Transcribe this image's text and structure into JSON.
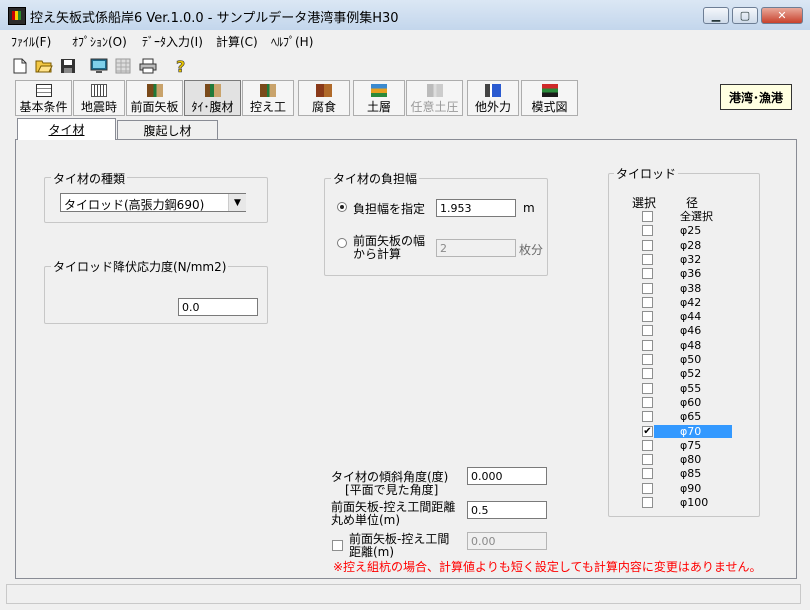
{
  "window": {
    "title": "控え矢板式係船岸6 Ver.1.0.0 - サンプルデータ港湾事例集H30"
  },
  "menu": [
    "ﾌｧｲﾙ(F)",
    "ｵﾌﾟｼｮﾝ(O)",
    "ﾃﾞｰﾀ入力(I)",
    "計算(C)",
    "ﾍﾙﾌﾟ(H)"
  ],
  "toolbar_icons": [
    "new-file-icon",
    "open-folder-icon",
    "save-icon",
    "monitor-icon",
    "table-icon",
    "printer-icon",
    "help-icon"
  ],
  "nav_buttons": [
    "基本条件",
    "地震時",
    "前面矢板",
    "ﾀｲ･腹材",
    "控え工",
    "腐食",
    "土層",
    "任意土圧",
    "他外力",
    "模式図"
  ],
  "region_badge": "港湾･漁港",
  "tabs": [
    "タイ材",
    "腹起し材"
  ],
  "tie_type": {
    "title": "タイ材の種類",
    "value": "タイロッド(高張力鋼690)"
  },
  "yield": {
    "title": "タイロッド降伏応力度(N/mm2)",
    "value": "0.0"
  },
  "load_width": {
    "title": "タイ材の負担幅",
    "opt_specify": "負担幅を指定",
    "specify_value": "1.953",
    "specify_unit": "m",
    "opt_calc_line1": "前面矢板の幅",
    "opt_calc_line2": "から計算",
    "calc_value": "2",
    "calc_unit": "枚分"
  },
  "tierod": {
    "title": "タイロッド",
    "col_select": "選択",
    "col_diameter": "径",
    "items": [
      "全選択",
      "φ25",
      "φ28",
      "φ32",
      "φ36",
      "φ38",
      "φ42",
      "φ44",
      "φ46",
      "φ48",
      "φ50",
      "φ52",
      "φ55",
      "φ60",
      "φ65",
      "φ70",
      "φ75",
      "φ80",
      "φ85",
      "φ90",
      "φ100"
    ],
    "selected": "φ70"
  },
  "incline": {
    "label1": "タイ材の傾斜角度(度)",
    "label2": "[平面で見た角度]",
    "value": "0.000"
  },
  "round_unit": {
    "label1": "前面矢板-控え工間距離",
    "label2": "丸め単位(m)",
    "value": "0.5"
  },
  "distance": {
    "label1": "前面矢板-控え工間",
    "label2": "距離(m)",
    "value": "0.00"
  },
  "note": "※控え組杭の場合、計算値よりも短く設定しても計算内容に変更はありません。",
  "colors": {
    "note": "#ff0000",
    "selection": "#3399ff"
  }
}
